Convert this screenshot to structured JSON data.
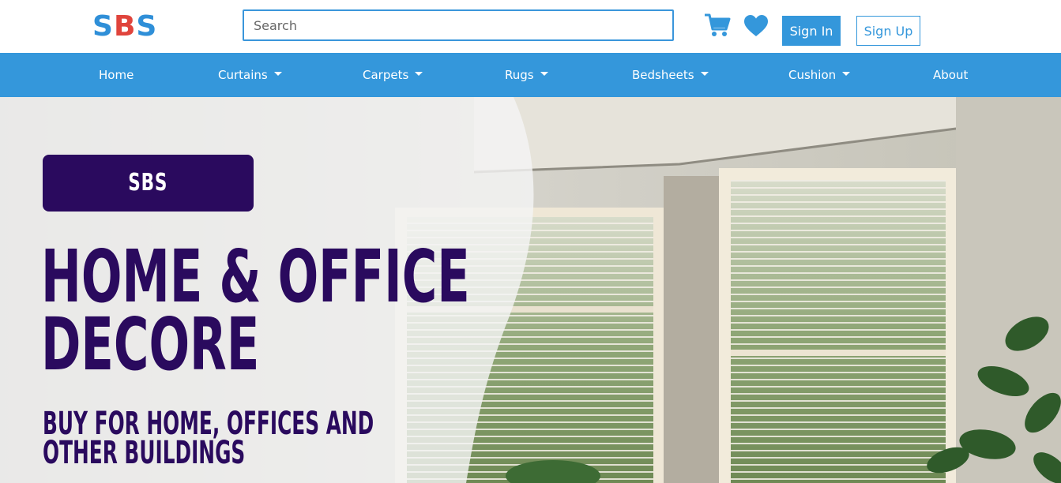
{
  "header": {
    "logo": {
      "part1": "S",
      "part2": "B",
      "part3": "S"
    },
    "search": {
      "placeholder": "Search",
      "value": ""
    },
    "icons": {
      "cart": "shopping-cart-icon",
      "wishlist": "heart-icon"
    },
    "sign_in_label": "Sign In",
    "sign_up_label": "Sign Up"
  },
  "nav": {
    "items": [
      {
        "label": "Home",
        "dropdown": false
      },
      {
        "label": "Curtains",
        "dropdown": true
      },
      {
        "label": "Carpets",
        "dropdown": true
      },
      {
        "label": "Rugs",
        "dropdown": true
      },
      {
        "label": "Bedsheets",
        "dropdown": true
      },
      {
        "label": "Cushion",
        "dropdown": true
      },
      {
        "label": "About",
        "dropdown": false
      }
    ]
  },
  "hero": {
    "badge": "SBS",
    "headline_line1": "HOME & OFFICE",
    "headline_line2": "DECORE",
    "subline_line1": "BUY FOR HOME, OFFICES AND",
    "subline_line2": "OTHER BUILDINGS"
  },
  "colors": {
    "primary": "#3497db",
    "logo_red": "#e0443c",
    "hero_text": "#2a0a5e"
  }
}
